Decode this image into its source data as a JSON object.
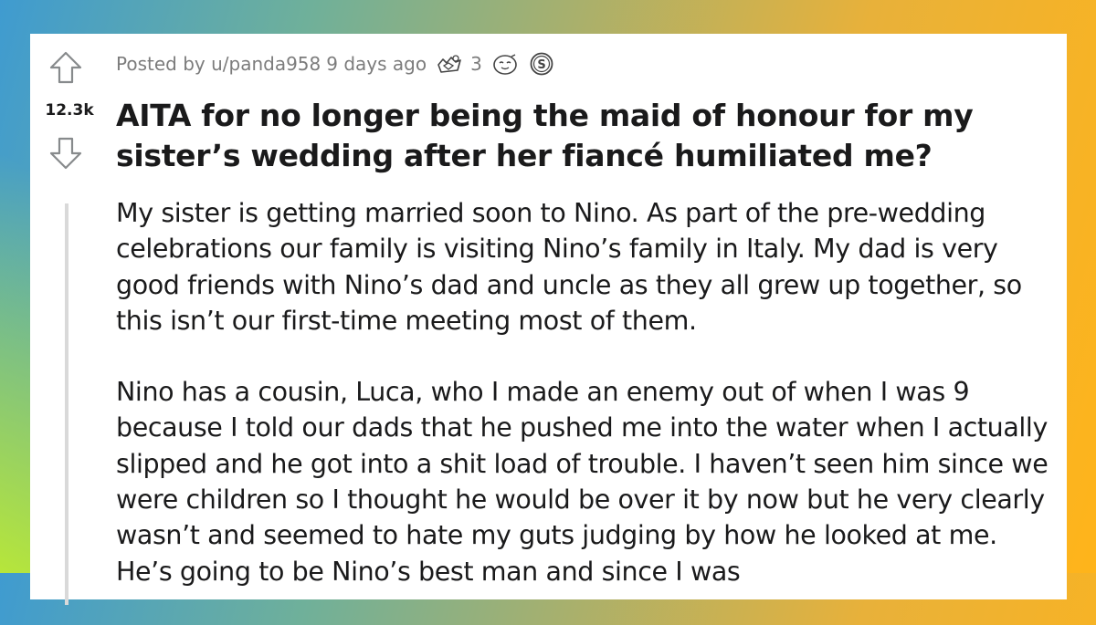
{
  "post": {
    "score": "12.3k",
    "meta": {
      "posted_by": "Posted by u/panda958",
      "time_ago": "9 days ago",
      "award_count": "3"
    },
    "awards": [
      "helpful-award-icon",
      "wholesome-award-icon",
      "silver-award-icon"
    ],
    "title": "AITA for no longer being the maid of honour for my sister’s wedding after her fiancé humiliated me?",
    "paragraphs": [
      "My sister is getting married soon to Nino. As part of the pre-wedding celebrations our family is visiting Nino’s family in Italy. My dad is very good friends with Nino’s dad and uncle as they all grew up together, so this isn’t our first-time meeting most of them.",
      "Nino has a cousin, Luca, who I made an enemy out of when I was 9 because I told our dads that he pushed me into the water when I actually slipped and he got into a shit load of trouble. I haven’t seen him since we were children so I thought he would be over it by now but he very clearly wasn’t and seemed to hate my guts judging by how he looked at me. He’s going to be Nino’s best man and since I was"
    ]
  },
  "colors": {
    "text": "#1a1a1b",
    "meta": "#7c7c7c",
    "arrow": "#878a8c"
  }
}
